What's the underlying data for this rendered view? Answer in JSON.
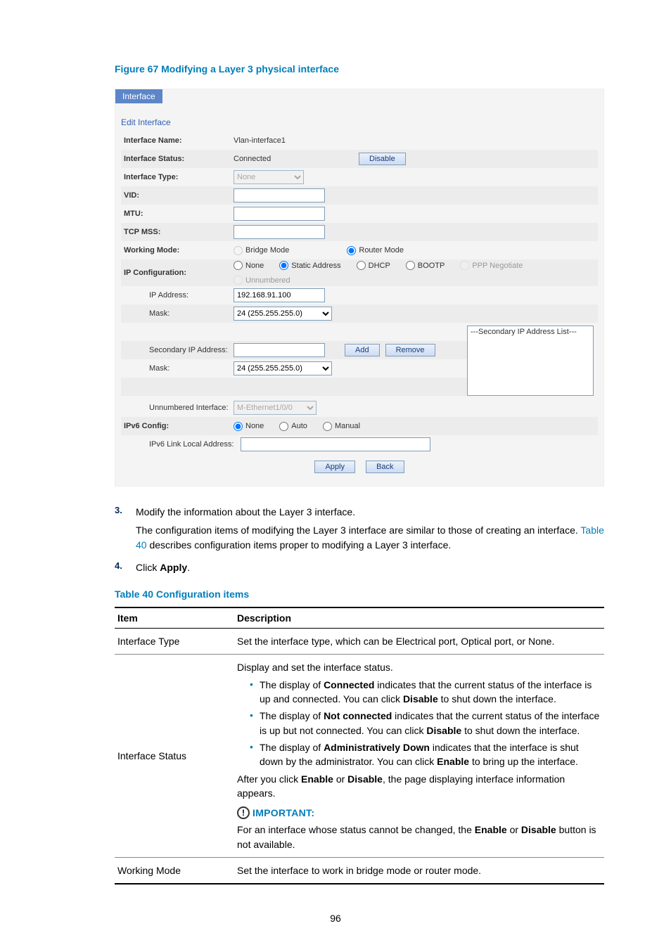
{
  "figure_caption": "Figure 67 Modifying a Layer 3 physical interface",
  "iface": {
    "tab": "Interface",
    "edit_head": "Edit Interface",
    "rows": {
      "name_label": "Interface Name:",
      "name_value": "Vlan-interface1",
      "status_label": "Interface Status:",
      "status_value": "Connected",
      "disable_btn": "Disable",
      "type_label": "Interface Type:",
      "type_value": "None",
      "vid_label": "VID:",
      "mtu_label": "MTU:",
      "tcpmss_label": "TCP MSS:",
      "wmode_label": "Working Mode:",
      "wmode_bridge": "Bridge Mode",
      "wmode_router": "Router Mode",
      "ipcfg_label": "IP Configuration:",
      "ipcfg_none": "None",
      "ipcfg_static": "Static Address",
      "ipcfg_dhcp": "DHCP",
      "ipcfg_bootp": "BOOTP",
      "ipcfg_ppp": "PPP Negotiate",
      "ipcfg_unnum": "Unnumbered",
      "ipaddr_label": "IP Address:",
      "ipaddr_value": "192.168.91.100",
      "mask_label": "Mask:",
      "mask_value": "24 (255.255.255.0)",
      "secip_label": "Secondary IP Address:",
      "secmask_label": "Mask:",
      "secmask_value": "24 (255.255.255.0)",
      "seclist_header": "---Secondary IP Address List---",
      "add_btn": "Add",
      "remove_btn": "Remove",
      "unnum_label": "Unnumbered Interface:",
      "unnum_value": "M-Ethernet1/0/0",
      "ipv6cfg_label": "IPv6 Config:",
      "ipv6cfg_none": "None",
      "ipv6cfg_auto": "Auto",
      "ipv6cfg_manual": "Manual",
      "ipv6ll_label": "IPv6 Link Local Address:",
      "apply_btn": "Apply",
      "back_btn": "Back"
    }
  },
  "steps": {
    "s3_num": "3.",
    "s3_text1": "Modify the information about the Layer 3 interface.",
    "s3_text2a": "The configuration items of modifying the Layer 3 interface are similar to those of creating an interface. ",
    "s3_table_link": "Table 40",
    "s3_text2b": " describes configuration items proper to modifying a Layer 3 interface.",
    "s4_num": "4.",
    "s4_text_pre": "Click ",
    "s4_text_bold": "Apply",
    "s4_text_post": "."
  },
  "table_caption": "Table 40 Configuration items",
  "table": {
    "h_item": "Item",
    "h_desc": "Description",
    "r1_item": "Interface Type",
    "r1_desc": "Set the interface type, which can be Electrical port, Optical port, or None.",
    "r2_item": "Interface Status",
    "r2_intro": "Display and set the interface status.",
    "r2_b1a": "The display of ",
    "r2_b1b": "Connected",
    "r2_b1c": " indicates that the current status of the interface is up and connected. You can click ",
    "r2_b1d": "Disable",
    "r2_b1e": " to shut down the interface.",
    "r2_b2a": "The display of ",
    "r2_b2b": "Not connected",
    "r2_b2c": " indicates that the current status of the interface is up but not connected. You can click ",
    "r2_b2d": "Disable",
    "r2_b2e": " to shut down the interface.",
    "r2_b3a": "The display of ",
    "r2_b3b": "Administratively Down",
    "r2_b3c": " indicates that the interface is shut down by the administrator. You can click ",
    "r2_b3d": "Enable",
    "r2_b3e": " to bring up the interface.",
    "r2_aftera": "After you click ",
    "r2_afterb": "Enable",
    "r2_afterc": " or ",
    "r2_afterd": "Disable",
    "r2_aftere": ", the page displaying interface information appears.",
    "r2_important": "IMPORTANT:",
    "r2_notea": "For an interface whose status cannot be changed, the ",
    "r2_noteb": "Enable",
    "r2_notec": " or ",
    "r2_noted": "Disable",
    "r2_notee": " button is not available.",
    "r3_item": "Working Mode",
    "r3_desc": "Set the interface to work in bridge mode or router mode."
  },
  "page_number": "96"
}
